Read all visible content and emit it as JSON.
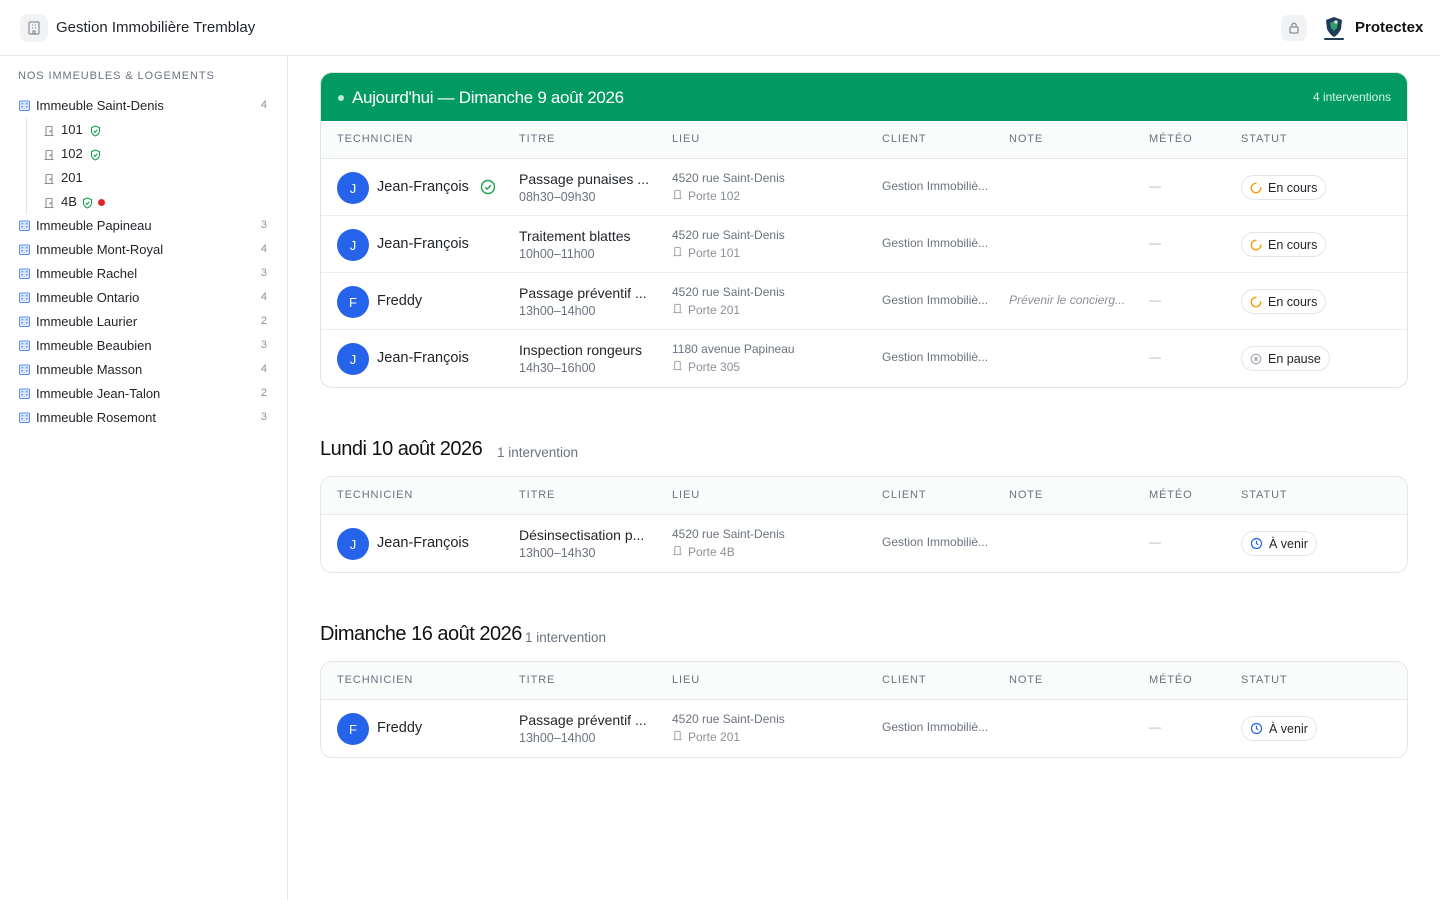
{
  "header": {
    "org_name": "Gestion Immobilière Tremblay",
    "brand_name": "Protectex",
    "org_icon": "building-icon",
    "lock_icon": "lock-icon"
  },
  "sidebar": {
    "title": "NOS IMMEUBLES & LOGEMENTS",
    "buildings": [
      {
        "name": "Immeuble Saint-Denis",
        "count": "4",
        "units": [
          {
            "name": "101",
            "shield": true,
            "alert": false
          },
          {
            "name": "102",
            "shield": true,
            "alert": false
          },
          {
            "name": "201",
            "shield": false,
            "alert": false
          },
          {
            "name": "4B",
            "shield": true,
            "alert": true
          }
        ]
      },
      {
        "name": "Immeuble Papineau",
        "count": "3"
      },
      {
        "name": "Immeuble Mont-Royal",
        "count": "4"
      },
      {
        "name": "Immeuble Rachel",
        "count": "3"
      },
      {
        "name": "Immeuble Ontario",
        "count": "4"
      },
      {
        "name": "Immeuble Laurier",
        "count": "2"
      },
      {
        "name": "Immeuble Beaubien",
        "count": "3"
      },
      {
        "name": "Immeuble Masson",
        "count": "4"
      },
      {
        "name": "Immeuble Jean-Talon",
        "count": "2"
      },
      {
        "name": "Immeuble Rosemont",
        "count": "3"
      }
    ]
  },
  "columns": [
    "TECHNICIEN",
    "TITRE",
    "LIEU",
    "CLIENT",
    "NOTE",
    "MÉTÉO",
    "STATUT"
  ],
  "colors": {
    "today_header": "#019a62",
    "avatar": "#2563eb",
    "alert_dot": "#dc2626",
    "shield": "#16a34a",
    "status_en_cours": "#f59e0b",
    "status_a_venir": "#2563eb",
    "status_en_pause": "#9ca3af"
  },
  "sections": [
    {
      "today": true,
      "title": "Aujourd'hui — Dimanche 9 août 2026",
      "count": "4 interventions",
      "rows": [
        {
          "initial": "J",
          "technician": "Jean-François",
          "verified": true,
          "title": "Passage punaises ...",
          "time": "08h30–09h30",
          "address": "4520 rue Saint-Denis",
          "porte": "Porte 102",
          "client": "Gestion Immobiliè...",
          "note": "",
          "meteo": "—",
          "status": "En cours",
          "status_icon": "spinner-icon"
        },
        {
          "initial": "J",
          "technician": "Jean-François",
          "verified": false,
          "title": "Traitement blattes",
          "time": "10h00–11h00",
          "address": "4520 rue Saint-Denis",
          "porte": "Porte 101",
          "client": "Gestion Immobiliè...",
          "note": "",
          "meteo": "—",
          "status": "En cours",
          "status_icon": "spinner-icon"
        },
        {
          "initial": "F",
          "technician": "Freddy",
          "verified": false,
          "title": "Passage préventif ...",
          "time": "13h00–14h00",
          "address": "4520 rue Saint-Denis",
          "porte": "Porte 201",
          "client": "Gestion Immobiliè...",
          "note": "Prévenir le concierg...",
          "meteo": "—",
          "status": "En cours",
          "status_icon": "spinner-icon"
        },
        {
          "initial": "J",
          "technician": "Jean-François",
          "verified": false,
          "title": "Inspection rongeurs",
          "time": "14h30–16h00",
          "address": "1180 avenue Papineau",
          "porte": "Porte 305",
          "client": "Gestion Immobiliè...",
          "note": "",
          "meteo": "—",
          "status": "En pause",
          "status_icon": "pause-icon"
        }
      ]
    },
    {
      "today": false,
      "title": "Lundi 10 août 2026",
      "count": "1 intervention",
      "rows": [
        {
          "initial": "J",
          "technician": "Jean-François",
          "verified": false,
          "title": "Désinsectisation p...",
          "time": "13h00–14h30",
          "address": "4520 rue Saint-Denis",
          "porte": "Porte 4B",
          "client": "Gestion Immobiliè...",
          "note": "",
          "meteo": "—",
          "status": "À venir",
          "status_icon": "clock-icon"
        }
      ]
    },
    {
      "today": false,
      "title": "Dimanche 16 août 2026",
      "count": "1 intervention",
      "rows": [
        {
          "initial": "F",
          "technician": "Freddy",
          "verified": false,
          "title": "Passage préventif ...",
          "time": "13h00–14h00",
          "address": "4520 rue Saint-Denis",
          "porte": "Porte 201",
          "client": "Gestion Immobiliè...",
          "note": "",
          "meteo": "—",
          "status": "À venir",
          "status_icon": "clock-icon"
        }
      ]
    }
  ]
}
